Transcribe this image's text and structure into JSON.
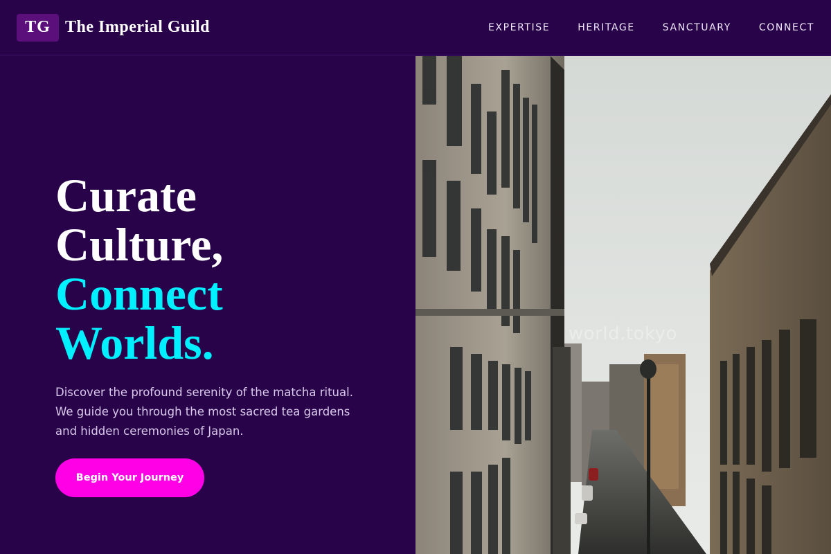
{
  "brand": {
    "mark": "TG",
    "name": "The Imperial Guild"
  },
  "nav": {
    "items": [
      {
        "label": "EXPERTISE"
      },
      {
        "label": "HERITAGE"
      },
      {
        "label": "SANCTUARY"
      },
      {
        "label": "CONNECT"
      }
    ]
  },
  "hero": {
    "headline": {
      "line1": "Curate",
      "line2": "Culture,",
      "line3": "Connect",
      "line4": "Worlds."
    },
    "description": "Discover the profound serenity of the matcha ritual. We guide you through the most sacred tea gardens and hidden ceremonies of Japan.",
    "cta_label": "Begin Your Journey"
  },
  "image": {
    "watermark": "world.tokyo"
  },
  "colors": {
    "background": "#28034a",
    "accent_cyan": "#00f0ff",
    "accent_magenta": "#ff00e6",
    "logo_mark": "#5a0f7a"
  }
}
